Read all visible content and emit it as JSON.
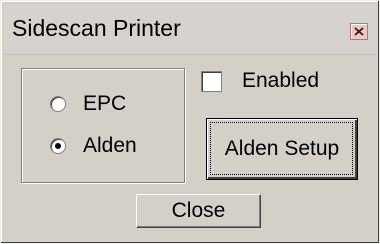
{
  "window": {
    "title": "Sidescan Printer",
    "close_icon": "close-x-icon",
    "close_icon_color": "#d04030"
  },
  "printer_group": {
    "options": [
      {
        "label": "EPC",
        "selected": false
      },
      {
        "label": "Alden",
        "selected": true
      }
    ]
  },
  "enabled_checkbox": {
    "label": "Enabled",
    "checked": false
  },
  "buttons": {
    "setup_label": "Alden Setup",
    "close_label": "Close"
  }
}
